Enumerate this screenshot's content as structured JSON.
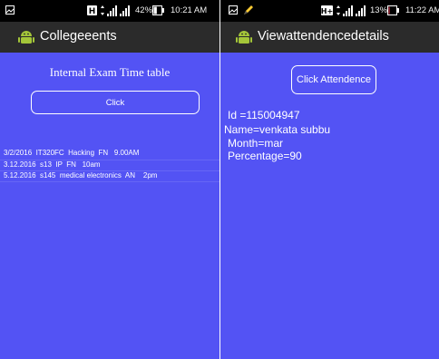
{
  "screens": {
    "left": {
      "statusbar": {
        "battery_percent": "42%",
        "time": "10:21 AM",
        "battery_level": 0.42
      },
      "app_title": "Collegeeents",
      "heading": "Internal Exam Time table",
      "button_label": "Click",
      "timetable_rows": [
        "3/2/2016  IT320FC  Hacking  FN   9.00AM",
        "3.12.2016  s13  IP  FN   10am",
        "5.12.2016  s145  medical electronics  AN    2pm"
      ]
    },
    "right": {
      "statusbar": {
        "battery_percent": "13%",
        "time": "11:22 AM",
        "battery_level": 0.13
      },
      "app_title": "Viewattendencedetails",
      "button_label": "Click Attendence",
      "details": {
        "id": "Id =115004947",
        "name": "Name=venkata subbu",
        "month": "Month=mar",
        "percentage": "Percentage=90"
      }
    }
  },
  "colors": {
    "content_background": "#5353f4",
    "appbar_background": "#2b2b2b",
    "statusbar_background": "#000000",
    "android_green": "#a4c639",
    "battery_low": "#e8455a"
  },
  "icons": [
    "sim-card-icon",
    "wifi-icon",
    "signal-icon",
    "battery-icon",
    "gallery-icon",
    "edit-icon",
    "android-logo-icon"
  ]
}
